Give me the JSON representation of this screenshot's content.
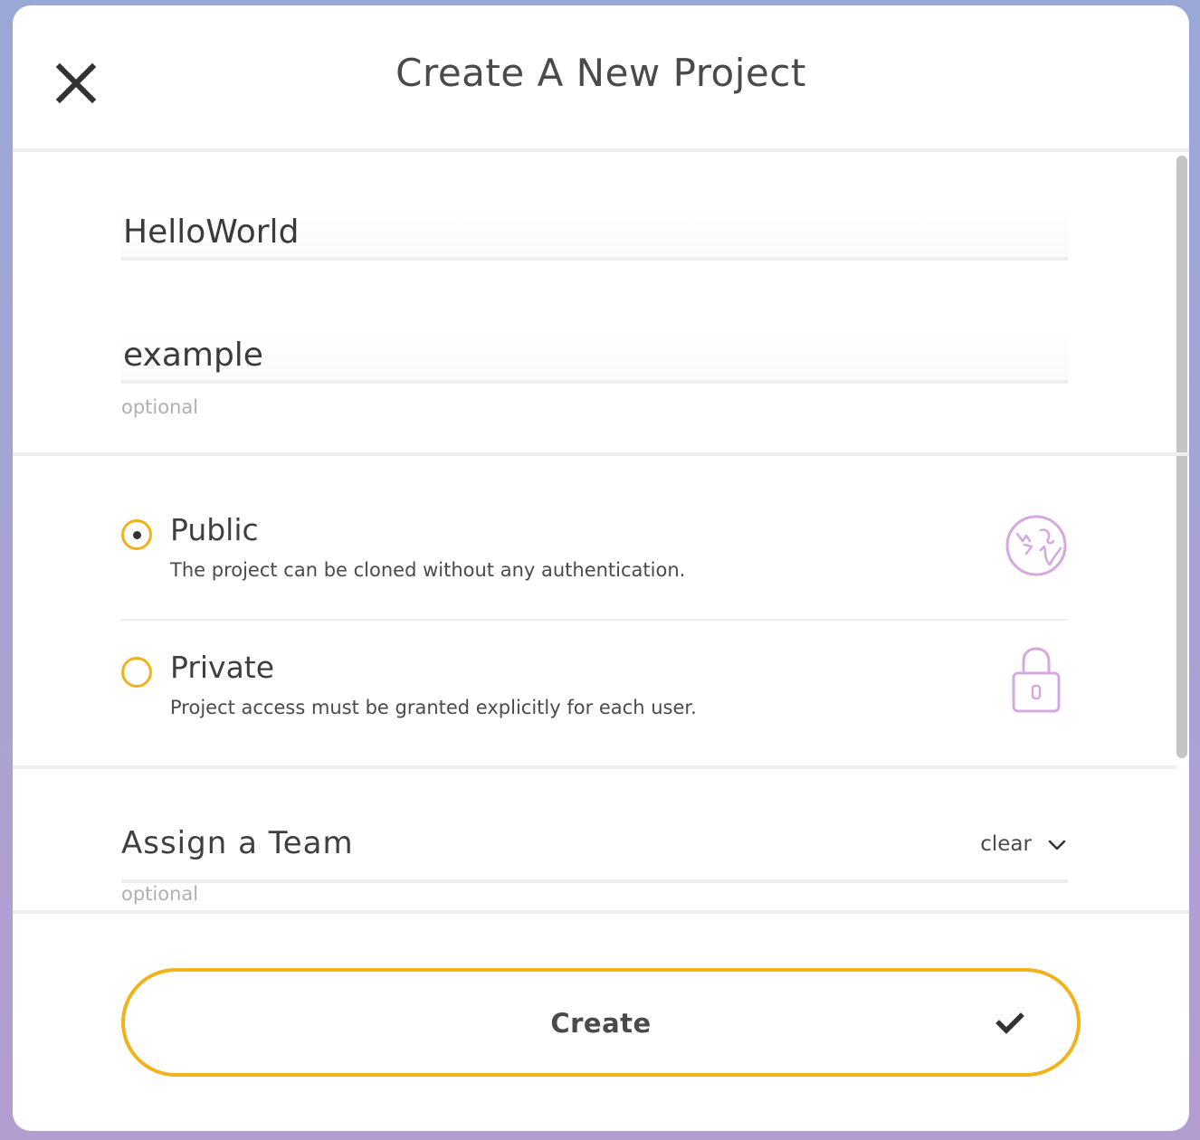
{
  "dialog": {
    "title": "Create A New Project",
    "close_icon": "close-icon"
  },
  "form": {
    "name": {
      "value": "HelloWorld"
    },
    "description": {
      "value": "example",
      "hint": "optional"
    },
    "visibility": {
      "selected": "public",
      "options": [
        {
          "id": "public",
          "label": "Public",
          "description": "The project can be cloned without any authentication.",
          "icon": "globe-icon",
          "selected": true
        },
        {
          "id": "private",
          "label": "Private",
          "description": "Project access must be granted explicitly for each user.",
          "icon": "lock-icon",
          "selected": false
        }
      ]
    },
    "team": {
      "label": "Assign a Team",
      "clear_label": "clear",
      "hint": "optional",
      "chevron_icon": "chevron-down-icon"
    }
  },
  "actions": {
    "create_label": "Create",
    "create_icon": "checkmark-icon"
  },
  "colors": {
    "accent": "#f2b21b",
    "icon_purple": "#d6a8e0",
    "text": "#4a4a4a",
    "hint": "#b0b0b0",
    "divider": "#eeeeee"
  }
}
